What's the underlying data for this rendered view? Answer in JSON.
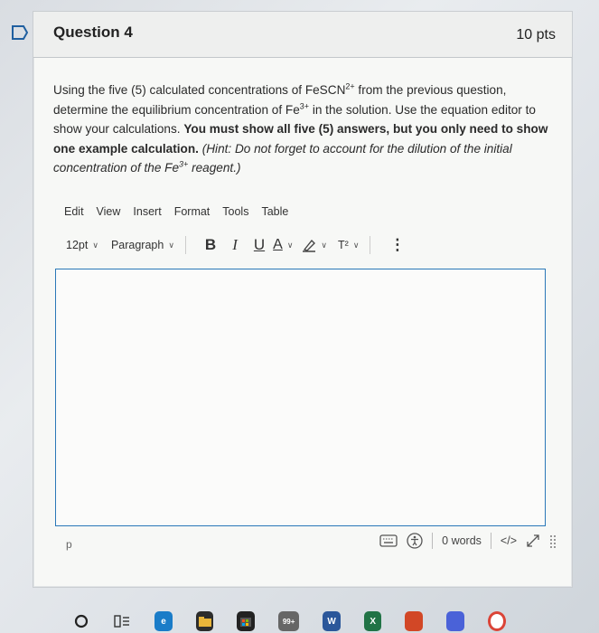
{
  "question": {
    "title": "Question 4",
    "points": "10 pts"
  },
  "prompt": {
    "part1": "Using the five (5) calculated concentrations of FeSCN",
    "sup1": "2+",
    "part2": " from the previous question, determine the equilibrium concentration of Fe",
    "sup2": "3+",
    "part3": " in the solution. Use the equation editor to show your calculations. ",
    "bold": "You must show all five (5) answers, but you only need to show one example calculation.",
    "hint1": " (Hint: Do not forget to account for the dilution of the initial concentration of the Fe",
    "sup3": "3+",
    "hint2": " reagent.)"
  },
  "editor": {
    "menu": [
      "Edit",
      "View",
      "Insert",
      "Format",
      "Tools",
      "Table"
    ],
    "font_size": "12pt",
    "block_format": "Paragraph",
    "bold": "B",
    "italic": "I",
    "underline": "U",
    "text_color": "A",
    "superscript": "T²",
    "more": "⋮",
    "path": "p",
    "word_count": "0 words",
    "html_toggle": "</>",
    "accent": "#2a78b8"
  },
  "dock": {
    "badge_count": "99+",
    "word_letter": "W",
    "excel_letter": "X"
  }
}
